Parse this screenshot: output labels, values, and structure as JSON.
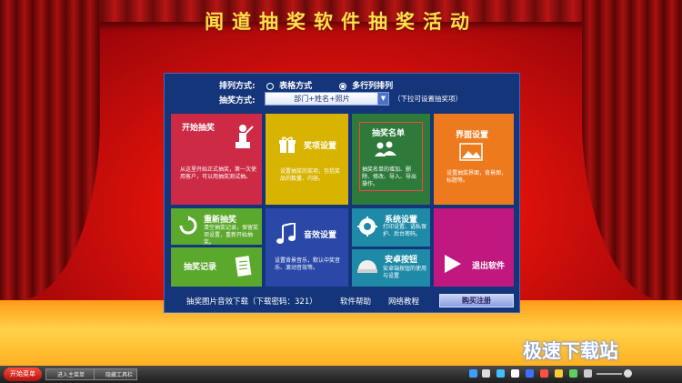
{
  "title": "闻道抽奖软件抽奖活动",
  "options": {
    "arrange_label": "排列方式:",
    "table_mode": "表格方式",
    "multirow_mode": "多行列排列",
    "draw_label": "抽奖方式:",
    "draw_select_value": "部门+姓名+照片",
    "hint": "（下拉可设置抽奖项）"
  },
  "tiles": {
    "start": {
      "title": "开始抽奖",
      "desc": "从这里开始正式抽奖，第一次使用客户，可以用抽奖测试抽。"
    },
    "prize": {
      "title": "奖项设置",
      "desc": "设置抽奖的奖项，包括奖品的数量、内容。"
    },
    "list": {
      "title": "抽奖名单",
      "desc": "抽奖名单的增加、删除、修改、导入、导出操作。"
    },
    "interface": {
      "title": "界面设置",
      "desc": "设置抽奖界面，背景图，标题等。"
    },
    "redraw": {
      "title": "重新抽奖",
      "desc": "清空抽奖记录，保留奖项设置，重新开始抽奖。"
    },
    "sound": {
      "title": "音效设置",
      "desc": "设置背景音乐，默认中奖音乐、滚动音效等。"
    },
    "system": {
      "title": "系统设置",
      "desc": "打印设置、语私保护、后台密码。"
    },
    "record": {
      "title": "抽奖记录"
    },
    "android": {
      "title": "安卓按钮",
      "desc": "安卓端按钮的使用与设置"
    },
    "exit": {
      "title": "退出软件"
    }
  },
  "bottom": {
    "download": "抽奖图片音效下载（下载密码：321）",
    "help": "软件帮助",
    "tutorial": "网络教程",
    "buy": "购买注册"
  },
  "watermark": "极速下载站",
  "taskbar": {
    "start": "开始菜单",
    "tab1": "进入主菜单",
    "tab2": "隐藏工具栏"
  },
  "colors": {
    "tile_red": "#cc2a45",
    "tile_yellow": "#d8b400",
    "tile_green": "#2d7a3a",
    "tile_orange": "#ee7a1e",
    "tile_lime": "#5aa82c",
    "tile_blue": "#2a48a8",
    "tile_teal": "#1e8aa8",
    "tile_magenta": "#c0187e"
  }
}
